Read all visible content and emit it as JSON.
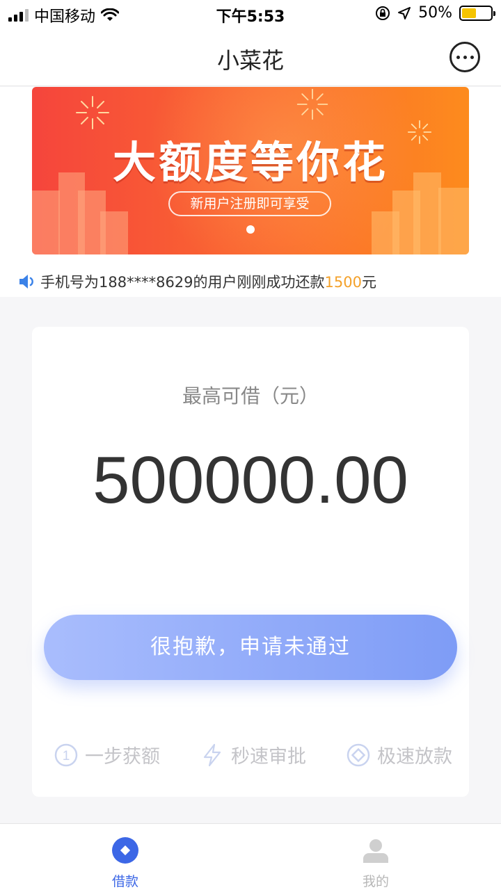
{
  "status_bar": {
    "carrier": "中国移动",
    "time": "下午5:53",
    "battery_percent": "50%",
    "battery_level": 0.5
  },
  "nav": {
    "title": "小菜花",
    "more_icon": "more-dots-icon"
  },
  "banner": {
    "title": "大额度等你花",
    "subtitle": "新用户注册即可享受",
    "slide_count": 1,
    "active_slide": 1
  },
  "notice": {
    "prefix": "手机号为188****8629的用户刚刚成功还款",
    "amount": "1500",
    "suffix": "元",
    "icon": "speaker-icon"
  },
  "loan_card": {
    "label": "最高可借（元）",
    "amount": "500000.00",
    "button_label": "很抱歉，申请未通过",
    "features": [
      {
        "icon": "step-one-icon",
        "label": "一步获额"
      },
      {
        "icon": "lightning-icon",
        "label": "秒速审批"
      },
      {
        "icon": "diamond-icon",
        "label": "极速放款"
      }
    ]
  },
  "tab_bar": {
    "tabs": [
      {
        "label": "借款",
        "icon": "loan-diamond-icon",
        "active": true
      },
      {
        "label": "我的",
        "icon": "profile-icon",
        "active": false
      }
    ]
  },
  "colors": {
    "accent": "#3c67e6",
    "button_start": "#a9bdfd",
    "button_end": "#7e9cf6",
    "notice_amount": "#f4a12a",
    "banner_start": "#f5453c",
    "banner_end": "#fd8b1d"
  }
}
